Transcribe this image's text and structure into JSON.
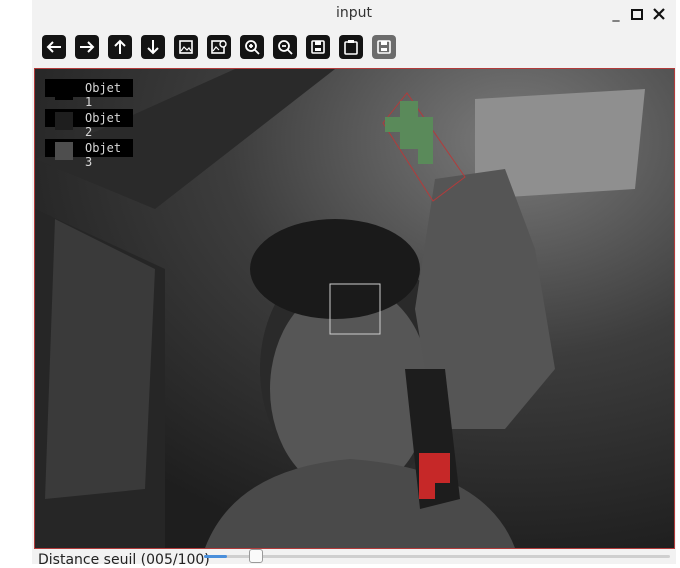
{
  "window": {
    "title": "input",
    "controls": {
      "minimize": "minimize-icon",
      "maximize": "maximize-icon",
      "close": "close-icon"
    }
  },
  "toolbar": {
    "buttons": [
      {
        "name": "back-button",
        "icon": "arrow-left-icon",
        "enabled": true
      },
      {
        "name": "forward-button",
        "icon": "arrow-right-icon",
        "enabled": true
      },
      {
        "name": "up-button",
        "icon": "arrow-up-icon",
        "enabled": true
      },
      {
        "name": "down-button",
        "icon": "arrow-down-icon",
        "enabled": true
      },
      {
        "name": "image-button",
        "icon": "image-icon",
        "enabled": true
      },
      {
        "name": "image-settings-button",
        "icon": "image-settings-icon",
        "enabled": true
      },
      {
        "name": "zoom-in-button",
        "icon": "zoom-in-icon",
        "enabled": true
      },
      {
        "name": "zoom-out-button",
        "icon": "zoom-out-icon",
        "enabled": true
      },
      {
        "name": "save-button",
        "icon": "save-icon",
        "enabled": true
      },
      {
        "name": "clipboard-button",
        "icon": "clipboard-icon",
        "enabled": true
      },
      {
        "name": "save-disabled-button",
        "icon": "save-icon",
        "enabled": false
      }
    ]
  },
  "legend": [
    {
      "label": "Objet 1",
      "color": "#000000"
    },
    {
      "label": "Objet 2",
      "color": "#1e1e1e"
    },
    {
      "label": "Objet 3",
      "color": "#4e4e4e"
    }
  ],
  "markers": {
    "object1_color": "#5a8a5a",
    "object2_color": "#c62828",
    "outline_color": "#b23b3b"
  },
  "status": {
    "label": "Distance seuil (005/100)",
    "slider_value": 5,
    "slider_max": 100
  }
}
